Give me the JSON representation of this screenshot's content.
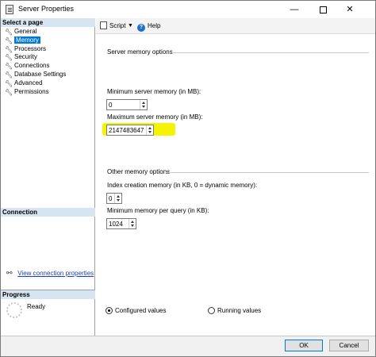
{
  "window": {
    "title": "Server Properties",
    "minimize": "—",
    "close": "✕"
  },
  "left": {
    "select_page_header": "Select a page",
    "pages": [
      {
        "label": "General",
        "selected": false
      },
      {
        "label": "Memory",
        "selected": true
      },
      {
        "label": "Processors",
        "selected": false
      },
      {
        "label": "Security",
        "selected": false
      },
      {
        "label": "Connections",
        "selected": false
      },
      {
        "label": "Database Settings",
        "selected": false
      },
      {
        "label": "Advanced",
        "selected": false
      },
      {
        "label": "Permissions",
        "selected": false
      }
    ],
    "connection_header": "Connection",
    "view_connection_link": "View connection properties",
    "progress_header": "Progress",
    "progress_status": "Ready"
  },
  "toolbar": {
    "script_label": "Script",
    "dropdown_glyph": "▼",
    "help_label": "Help",
    "help_glyph": "?"
  },
  "options": {
    "server_memory_group": "Server memory options",
    "min_server_memory_label": "Minimum server memory (in MB):",
    "min_server_memory_value": "0",
    "max_server_memory_label": "Maximum server memory (in MB):",
    "max_server_memory_value": "2147483647",
    "other_memory_group": "Other memory options",
    "index_creation_label": "Index creation memory (in KB, 0 = dynamic memory):",
    "index_creation_value": "0",
    "min_query_label": "Minimum memory per query (in KB):",
    "min_query_value": "1024"
  },
  "radios": {
    "configured_label": "Configured values",
    "running_label": "Running values",
    "selected": "configured"
  },
  "buttons": {
    "ok_label": "OK",
    "cancel_label": "Cancel"
  },
  "colors": {
    "selection": "#0078d7",
    "highlight": "#f5f400",
    "header_bg": "#d7e4f2"
  }
}
